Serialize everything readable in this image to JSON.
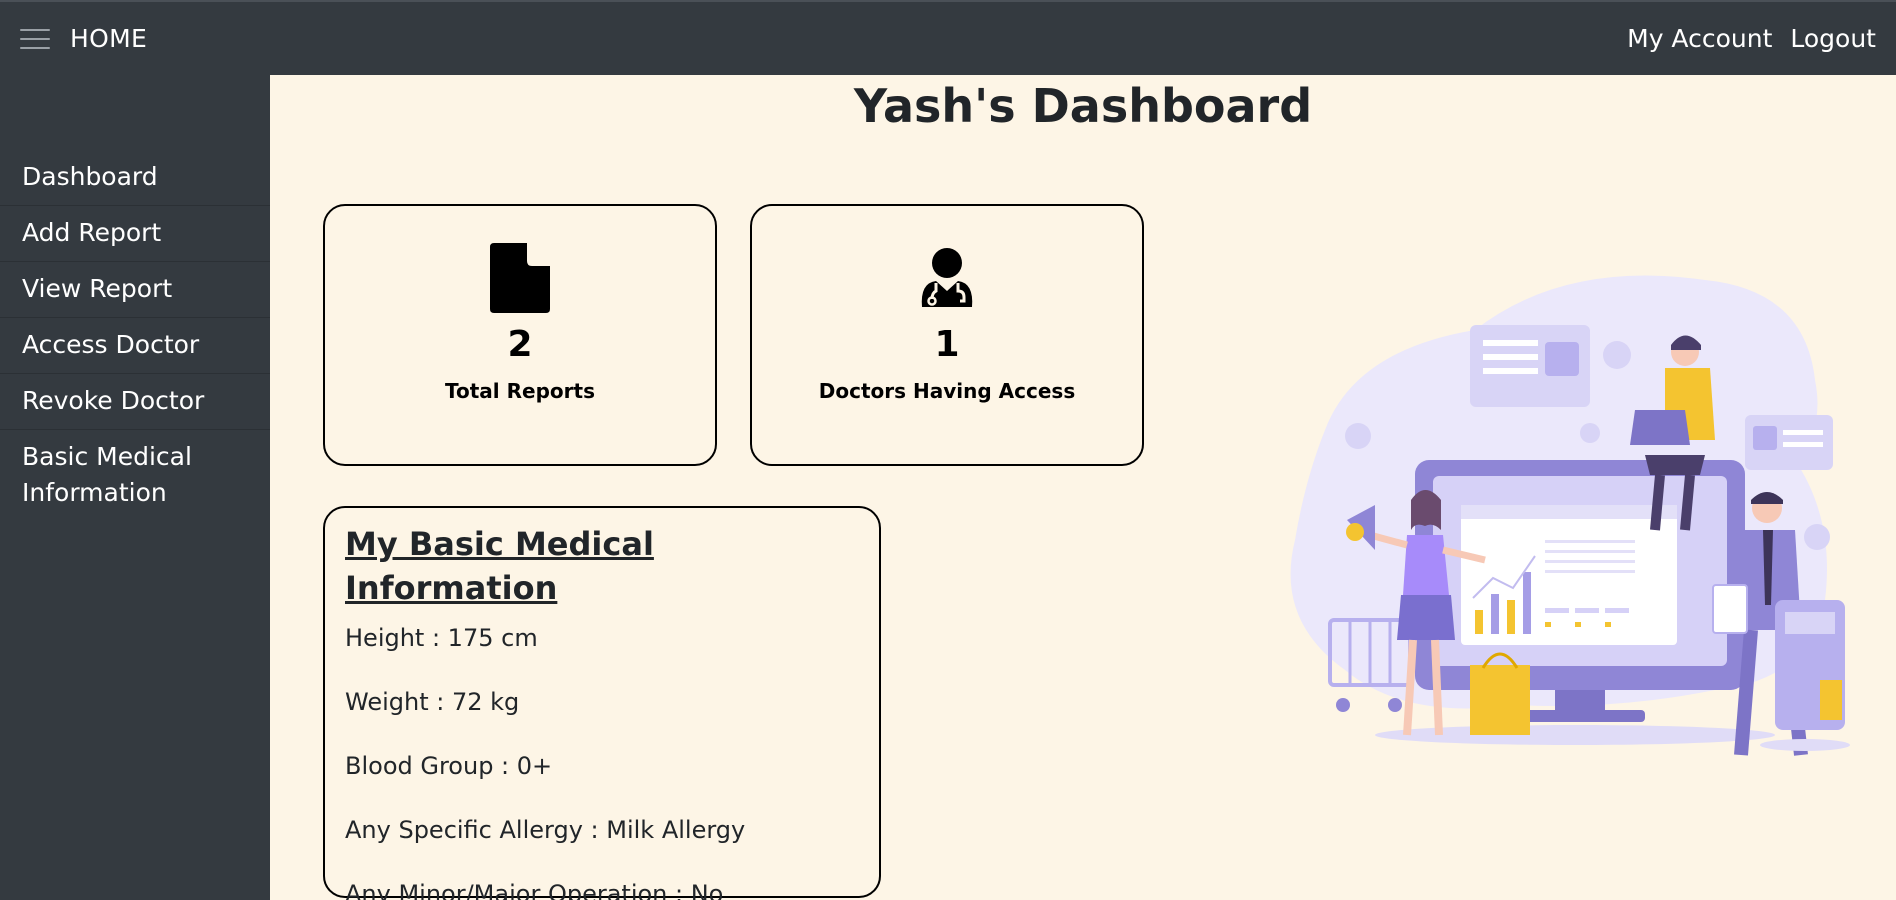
{
  "topbar": {
    "brand": "HOME",
    "links": [
      "My Account",
      "Logout"
    ]
  },
  "sidebar": {
    "items": [
      "Dashboard",
      "Add Report",
      "View Report",
      "Access Doctor",
      "Revoke Doctor",
      "Basic Medical Information"
    ]
  },
  "page": {
    "title": "Yash's Dashboard"
  },
  "stats": [
    {
      "icon": "file-icon",
      "value": "2",
      "label": "Total Reports"
    },
    {
      "icon": "doctor-icon",
      "value": "1",
      "label": "Doctors Having Access"
    }
  ],
  "medical_info": {
    "title": "My Basic Medical Information",
    "rows": [
      "Height : 175 cm",
      "Weight : 72 kg",
      "Blood Group : 0+",
      "Any Specific Allergy : Milk Allergy",
      "Any Minor/Major Operation : No"
    ]
  },
  "colors": {
    "nav_bg": "#343a40",
    "page_bg": "#fdf5e6",
    "accent_purple": "#8b80d8",
    "accent_yellow": "#f4c430"
  }
}
